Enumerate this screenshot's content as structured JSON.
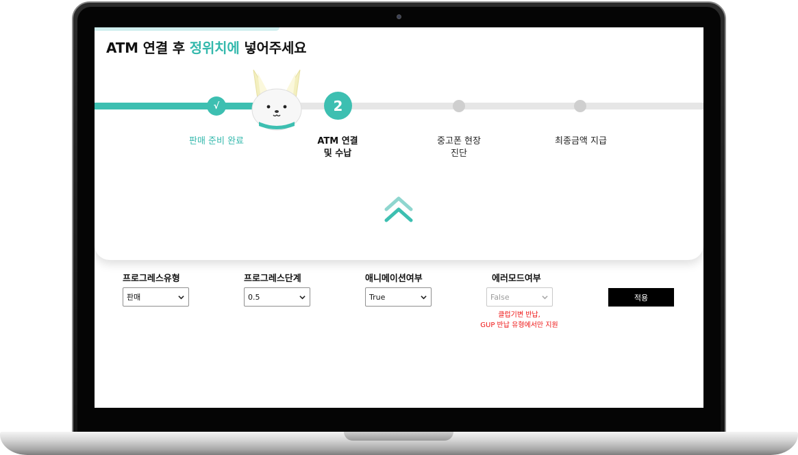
{
  "heading": {
    "prefix": "ATM 연결 후 ",
    "highlight": "정위치에",
    "suffix": " 넣어주세요"
  },
  "progress": {
    "done_mark": "√",
    "current_number": "2",
    "steps": [
      {
        "label_line1": "판매 준비 완료",
        "label_line2": "",
        "state": "done"
      },
      {
        "label_line1": "ATM 연결",
        "label_line2": "및 수납",
        "state": "current"
      },
      {
        "label_line1": "중고폰 현장",
        "label_line2": "진단",
        "state": "pending"
      },
      {
        "label_line1": "최종금액 지급",
        "label_line2": "",
        "state": "pending"
      }
    ]
  },
  "controls": {
    "progress_type": {
      "label": "프로그레스유형",
      "value": "판매"
    },
    "progress_stage": {
      "label": "프로그레스단계",
      "value": "0.5"
    },
    "animation": {
      "label": "애니메이션여부",
      "value": "True"
    },
    "error_mode": {
      "label": "에러모드여부",
      "value": "False",
      "disabled": true
    },
    "apply_label": "적용",
    "error_note_line1": "클럽기변 반납,",
    "error_note_line2": "GUP 반납 유형에서만 지원"
  },
  "colors": {
    "accent": "#3dbfb1",
    "error_text": "#ee1111",
    "inactive_dot": "#cfcfcf",
    "track": "#e6e6e6",
    "mascot_ears": "#f3efbf"
  },
  "icons": {
    "mascot": "fox-mascot-icon",
    "scroll_up": "double-chevron-up-icon",
    "dropdown": "chevron-down-icon"
  }
}
